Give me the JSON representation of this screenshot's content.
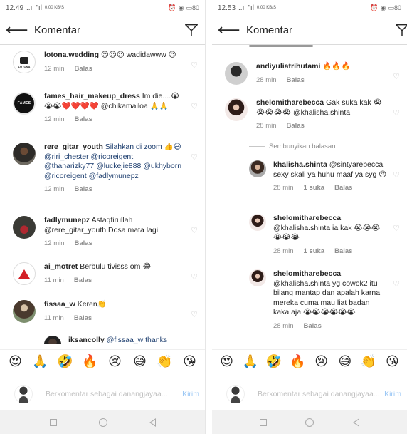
{
  "left": {
    "status": {
      "time": "12.49",
      "signal": "..ıl \"ıl",
      "speed": "0,00 KB/S",
      "battery": "80"
    },
    "header": {
      "title": "Komentar"
    },
    "comments": [
      {
        "user": "lotona.wedding",
        "text": "😍😍😍 wadidawww 😍",
        "time": "12 min",
        "reply": "Balas",
        "avatar": "lotona",
        "logo_text": "LOTONA"
      },
      {
        "user": "fames_hair_makeup_dress",
        "text": "Im die....😭😭😭❤️❤️❤️❤️ @chikamailoa 🙏🙏",
        "time": "12 min",
        "reply": "Balas",
        "avatar": "fames",
        "logo_text": "FAMES"
      },
      {
        "user": "rere_gitar_youth",
        "text": "Silahkan di zoom 👍😃 @riri_chester @ricoreigent @thanarizky77 @luckejie888 @ukhyborn @ricoreigent @fadlymunepz",
        "time": "12 min",
        "reply": "Balas",
        "avatar": "rere"
      },
      {
        "user": "fadlymunepz",
        "text": "Astaqfirullah @rere_gitar_youth Dosa mata lagi",
        "time": "12 min",
        "reply": "Balas",
        "avatar": "fadly"
      },
      {
        "user": "ai_motret",
        "text": "Berbulu tivisss om 😂",
        "time": "11 min",
        "reply": "Balas",
        "avatar": "ai"
      },
      {
        "user": "fissaa_w",
        "text": "Keren👏",
        "time": "11 min",
        "reply": "Balas",
        "avatar": "fissaa"
      },
      {
        "user": "iksancolly",
        "text": "@fissaa_w thanks",
        "time": "",
        "reply": "",
        "avatar": "iksan"
      }
    ],
    "composer": {
      "placeholder": "Berkomentar sebagai danangjayaa...",
      "post": "Kirim"
    }
  },
  "right": {
    "status": {
      "time": "12.53",
      "signal": "..ıl \"ıl",
      "speed": "0,00 KB/S",
      "battery": "80"
    },
    "header": {
      "title": "Komentar"
    },
    "comments": [
      {
        "user": "andiyuliatrihutami",
        "text": "🔥🔥🔥",
        "time": "28 min",
        "reply": "Balas",
        "avatar": "andi"
      },
      {
        "user": "shelomitharebecca",
        "text": "Gak suka kak 😭😭😭😭😭 @khalisha.shinta",
        "time": "28 min",
        "reply": "Balas",
        "avatar": "shelo"
      },
      {
        "user": "khalisha.shinta",
        "text": "@sintyarebecca sexy skali ya  huhu maaf ya syg 😢",
        "time": "28 min",
        "likes": "1 suka",
        "reply": "Balas",
        "avatar": "khal"
      },
      {
        "user": "shelomitharebecca",
        "text": "@khalisha.shinta ia kak 😭😭😭😭😭😭",
        "time": "28 min",
        "likes": "1 suka",
        "reply": "Balas",
        "avatar": "shelo"
      },
      {
        "user": "shelomitharebecca",
        "text": "@khalisha.shinta yg cowok2 itu bilang mantap dan apalah karna mereka cuma mau liat badan kaka aja 😭😭😭😭😭😭",
        "time": "28 min",
        "reply": "Balas",
        "avatar": "shelo"
      }
    ],
    "hide_replies": "Sembunyikan balasan",
    "composer": {
      "placeholder": "Berkomentar sebagai danangjayaa...",
      "post": "Kirim"
    }
  },
  "emoji_bar": [
    "😍",
    "🙏",
    "🤣",
    "🔥",
    "😢",
    "😅",
    "👏",
    "😘"
  ],
  "colors": {
    "mention": "#1c3d6e",
    "meta": "#8e8e8e",
    "post_disabled": "#9cc8f5",
    "nav_bg": "#f1f1f1"
  },
  "icons": {
    "back": "arrow-left",
    "send": "paper-plane",
    "heart": "heart-outline"
  }
}
